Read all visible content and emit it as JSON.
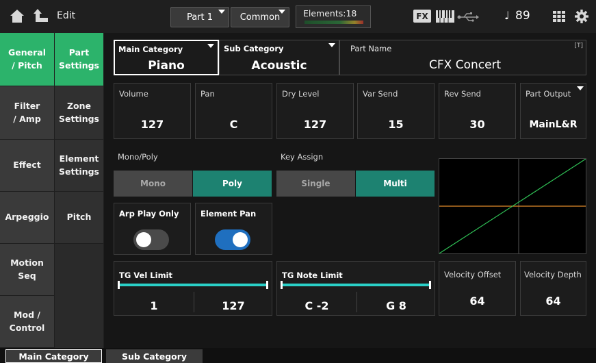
{
  "header": {
    "home_icon": "home-icon",
    "back_icon": "back-arrow-icon",
    "title": "Edit",
    "part_button": "Part 1",
    "common_button": "Common",
    "elements_label": "Elements:18",
    "fx_label": "FX",
    "keyboard_icon": "keyboard-icon",
    "usb_icon": "usb-icon",
    "tempo_icon": "note-icon",
    "tempo": "89",
    "grid_icon": "grid-icon",
    "settings_icon": "gear-icon"
  },
  "sidebar": {
    "items": [
      {
        "label": "General\n/ Pitch"
      },
      {
        "label": "Filter\n/ Amp"
      },
      {
        "label": "Effect"
      },
      {
        "label": "Arpeggio"
      },
      {
        "label": "Motion Seq"
      },
      {
        "label": "Mod /\nControl"
      }
    ]
  },
  "subnav": {
    "items": [
      {
        "label": "Part\nSettings"
      },
      {
        "label": "Zone\nSettings"
      },
      {
        "label": "Element\nSettings"
      },
      {
        "label": "Pitch"
      }
    ]
  },
  "category": {
    "main_label": "Main Category",
    "main_value": "Piano",
    "sub_label": "Sub Category",
    "sub_value": "Acoustic",
    "name_label": "Part Name",
    "name_value": "CFX Concert",
    "name_tag": "[T]"
  },
  "params": {
    "volume_label": "Volume",
    "volume": "127",
    "pan_label": "Pan",
    "pan": "C",
    "dry_label": "Dry Level",
    "dry": "127",
    "var_label": "Var Send",
    "var": "15",
    "rev_label": "Rev Send",
    "rev": "30",
    "output_label": "Part Output",
    "output": "MainL&R"
  },
  "mono_poly": {
    "label": "Mono/Poly",
    "mono": "Mono",
    "poly": "Poly",
    "selected": "Poly"
  },
  "key_assign": {
    "label": "Key Assign",
    "single": "Single",
    "multi": "Multi",
    "selected": "Multi"
  },
  "arp_play_only": {
    "label": "Arp Play Only",
    "on": false
  },
  "element_pan": {
    "label": "Element Pan",
    "on": true
  },
  "tg_vel_limit": {
    "label": "TG Vel Limit",
    "low": "1",
    "high": "127"
  },
  "tg_note_limit": {
    "label": "TG Note Limit",
    "low": "C -2",
    "high": "G 8"
  },
  "velocity": {
    "offset_label": "Velocity Offset",
    "offset": "64",
    "depth_label": "Velocity Depth",
    "depth": "64"
  },
  "bottom_tabs": {
    "main": "Main Category",
    "sub": "Sub Category"
  },
  "colors": {
    "accent_green": "#2cb36b",
    "teal": "#1d8271",
    "toggle_blue": "#1f6fbf",
    "curve_green": "#2fbf55",
    "curve_orange": "#e08a2a",
    "bar_cyan": "#2ad0c8"
  }
}
